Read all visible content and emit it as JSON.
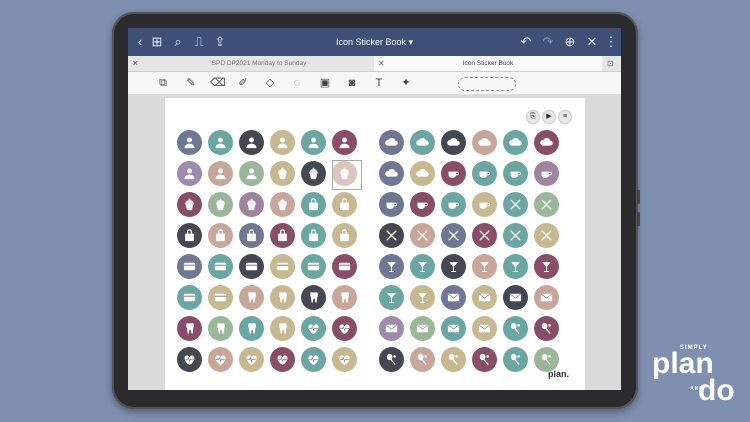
{
  "window": {
    "title": "Icon Sticker Book"
  },
  "tabs": [
    {
      "label": "SPD DP2021 Monday to Sunday",
      "active": false
    },
    {
      "label": "Icon Sticker Book",
      "active": true
    }
  ],
  "branding": {
    "page_mark": "plan.",
    "logo_simply": "SIMPLY",
    "logo_plan": "plan",
    "logo_and": "AND",
    "logo_do": "do"
  },
  "palette": {
    "slate": "#6f7794",
    "teal": "#6aa7a2",
    "dark": "#454852",
    "sand": "#c6b88f",
    "blush": "#c8a79a",
    "plum": "#8a4d67",
    "sage": "#9bb799",
    "lavender": "#9d8bae",
    "mauve": "#a0839f"
  },
  "left_grid": [
    [
      {
        "c": "slate",
        "i": "person"
      },
      {
        "c": "teal",
        "i": "person"
      },
      {
        "c": "dark",
        "i": "person"
      },
      {
        "c": "sand",
        "i": "person"
      },
      {
        "c": "teal",
        "i": "person"
      },
      {
        "c": "plum",
        "i": "person"
      }
    ],
    [
      {
        "c": "lavender",
        "i": "person"
      },
      {
        "c": "blush",
        "i": "person"
      },
      {
        "c": "sage",
        "i": "person"
      },
      {
        "c": "sand",
        "i": "cupcake"
      },
      {
        "c": "dark",
        "i": "cupcake"
      },
      {
        "c": "blush",
        "i": "cupcake"
      }
    ],
    [
      {
        "c": "plum",
        "i": "cupcake"
      },
      {
        "c": "sage",
        "i": "cupcake"
      },
      {
        "c": "mauve",
        "i": "cupcake"
      },
      {
        "c": "blush",
        "i": "cupcake"
      },
      {
        "c": "teal",
        "i": "bag"
      },
      {
        "c": "sand",
        "i": "bag"
      }
    ],
    [
      {
        "c": "dark",
        "i": "bag"
      },
      {
        "c": "blush",
        "i": "bag"
      },
      {
        "c": "slate",
        "i": "bag"
      },
      {
        "c": "plum",
        "i": "bag"
      },
      {
        "c": "teal",
        "i": "bag"
      },
      {
        "c": "sand",
        "i": "bag"
      }
    ],
    [
      {
        "c": "slate",
        "i": "card"
      },
      {
        "c": "teal",
        "i": "card"
      },
      {
        "c": "dark",
        "i": "card"
      },
      {
        "c": "sand",
        "i": "card"
      },
      {
        "c": "teal",
        "i": "card"
      },
      {
        "c": "plum",
        "i": "card"
      }
    ],
    [
      {
        "c": "teal",
        "i": "card"
      },
      {
        "c": "sand",
        "i": "card"
      },
      {
        "c": "blush",
        "i": "tooth"
      },
      {
        "c": "sand",
        "i": "tooth"
      },
      {
        "c": "dark",
        "i": "tooth"
      },
      {
        "c": "blush",
        "i": "tooth"
      }
    ],
    [
      {
        "c": "plum",
        "i": "tooth"
      },
      {
        "c": "sage",
        "i": "tooth"
      },
      {
        "c": "teal",
        "i": "tooth"
      },
      {
        "c": "sand",
        "i": "tooth"
      },
      {
        "c": "teal",
        "i": "heart"
      },
      {
        "c": "plum",
        "i": "heart"
      }
    ],
    [
      {
        "c": "dark",
        "i": "heart"
      },
      {
        "c": "blush",
        "i": "heart"
      },
      {
        "c": "sand",
        "i": "heart"
      },
      {
        "c": "plum",
        "i": "heart"
      },
      {
        "c": "teal",
        "i": "heart"
      },
      {
        "c": "sand",
        "i": "heart"
      }
    ]
  ],
  "right_grid": [
    [
      {
        "c": "slate",
        "i": "cloud"
      },
      {
        "c": "teal",
        "i": "cloud"
      },
      {
        "c": "dark",
        "i": "cloud"
      },
      {
        "c": "blush",
        "i": "cloud"
      },
      {
        "c": "teal",
        "i": "cloud"
      },
      {
        "c": "plum",
        "i": "cloud"
      }
    ],
    [
      {
        "c": "slate",
        "i": "cloud"
      },
      {
        "c": "sand",
        "i": "cloud"
      },
      {
        "c": "plum",
        "i": "cup"
      },
      {
        "c": "teal",
        "i": "cup"
      },
      {
        "c": "teal",
        "i": "cup"
      },
      {
        "c": "mauve",
        "i": "cup"
      }
    ],
    [
      {
        "c": "slate",
        "i": "cup"
      },
      {
        "c": "plum",
        "i": "cup"
      },
      {
        "c": "teal",
        "i": "cup"
      },
      {
        "c": "sand",
        "i": "cup"
      },
      {
        "c": "teal",
        "i": "cross"
      },
      {
        "c": "sage",
        "i": "cross"
      }
    ],
    [
      {
        "c": "dark",
        "i": "cross"
      },
      {
        "c": "blush",
        "i": "cross"
      },
      {
        "c": "slate",
        "i": "cross"
      },
      {
        "c": "plum",
        "i": "cross"
      },
      {
        "c": "teal",
        "i": "cross"
      },
      {
        "c": "sand",
        "i": "cross"
      }
    ],
    [
      {
        "c": "slate",
        "i": "glass"
      },
      {
        "c": "teal",
        "i": "glass"
      },
      {
        "c": "dark",
        "i": "glass"
      },
      {
        "c": "blush",
        "i": "glass"
      },
      {
        "c": "teal",
        "i": "glass"
      },
      {
        "c": "plum",
        "i": "glass"
      }
    ],
    [
      {
        "c": "teal",
        "i": "glass"
      },
      {
        "c": "sand",
        "i": "glass"
      },
      {
        "c": "slate",
        "i": "mail"
      },
      {
        "c": "sand",
        "i": "mail"
      },
      {
        "c": "dark",
        "i": "mail"
      },
      {
        "c": "blush",
        "i": "mail"
      }
    ],
    [
      {
        "c": "lavender",
        "i": "mail"
      },
      {
        "c": "sage",
        "i": "mail"
      },
      {
        "c": "teal",
        "i": "mail"
      },
      {
        "c": "sand",
        "i": "mail"
      },
      {
        "c": "teal",
        "i": "racket"
      },
      {
        "c": "plum",
        "i": "racket"
      }
    ],
    [
      {
        "c": "dark",
        "i": "racket"
      },
      {
        "c": "blush",
        "i": "racket"
      },
      {
        "c": "sand",
        "i": "racket"
      },
      {
        "c": "plum",
        "i": "racket"
      },
      {
        "c": "teal",
        "i": "racket"
      },
      {
        "c": "sage",
        "i": "racket"
      }
    ]
  ]
}
